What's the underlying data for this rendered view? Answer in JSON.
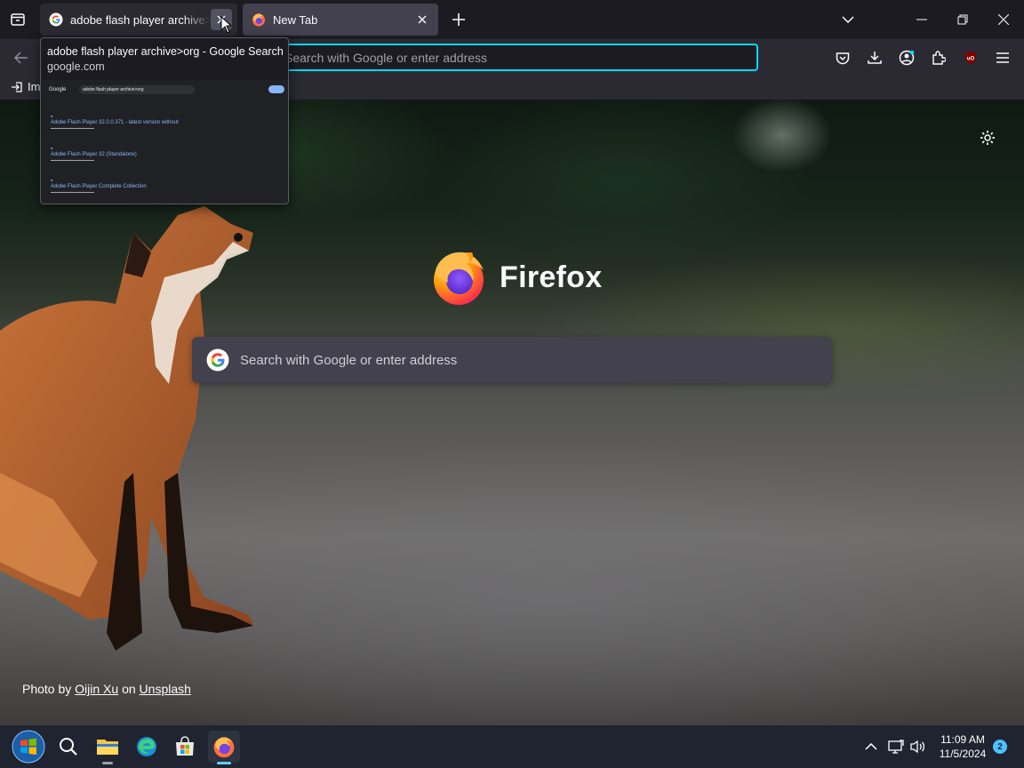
{
  "tabs": [
    {
      "title": "adobe flash player archive>org - Google Search",
      "favicon": "google-g-icon",
      "active": false,
      "hovered": true
    },
    {
      "title": "New Tab",
      "favicon": "firefox-logo-icon",
      "active": true
    }
  ],
  "tab_preview": {
    "title": "adobe flash player archive>org - Google Search",
    "host": "google.com",
    "thumb": {
      "logo": "Google",
      "query": "adobe flash player archive>org",
      "results": [
        {
          "link": "Adobe Flash Player 32.0.0.371 - latest version without"
        },
        {
          "link": "Adobe Flash Player 32 (Standalone)"
        },
        {
          "link": "Adobe Flash Player Complete Collection"
        }
      ]
    }
  },
  "urlbar": {
    "placeholder": "Search with Google or enter address"
  },
  "bookmarks": [
    {
      "label": "Im"
    }
  ],
  "newtab": {
    "brand": "Firefox",
    "search_placeholder": "Search with Google or enter address",
    "attribution": {
      "prefix": "Photo by",
      "author": "Oijin Xu",
      "middle": "on",
      "site": "Unsplash"
    }
  },
  "taskbar": {
    "clock_time": "11:09 AM",
    "clock_date": "11/5/2024",
    "notification_count": "2"
  },
  "colors": {
    "accent_focus": "#00ddff",
    "toolbar": "#2b2a33",
    "tabstrip": "#1c1b22",
    "active_tab": "#42414d"
  }
}
